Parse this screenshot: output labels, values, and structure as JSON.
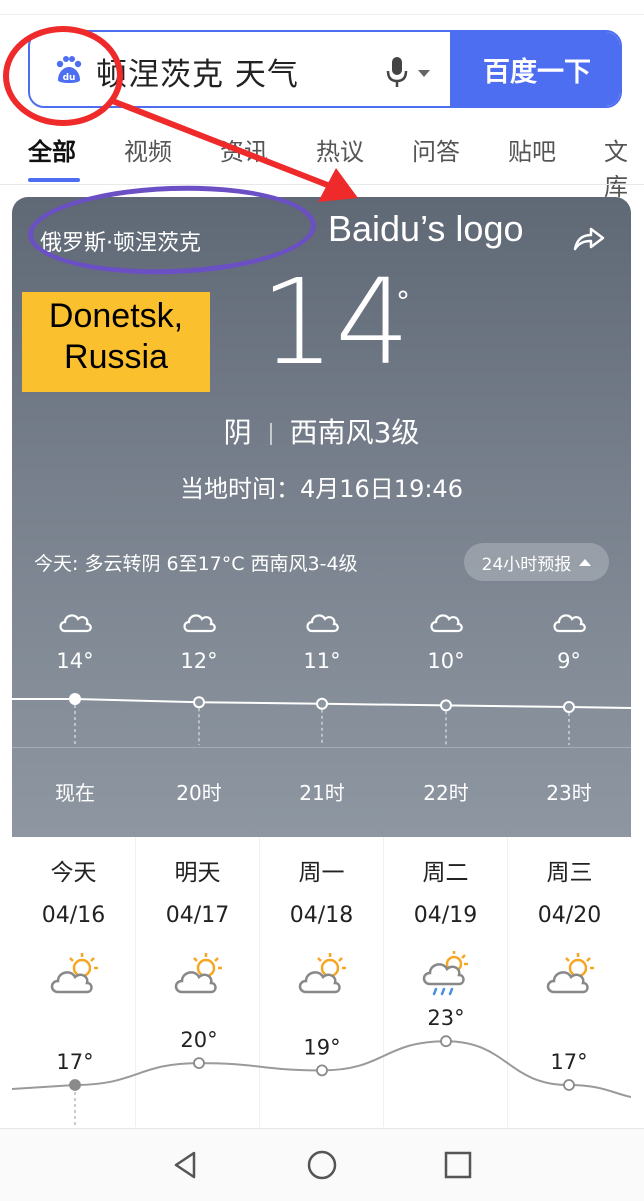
{
  "search": {
    "query": "顿涅茨克 天气",
    "button_label": "百度一下",
    "logo_text": "du"
  },
  "tabs": [
    {
      "label": "全部",
      "active": true
    },
    {
      "label": "视频"
    },
    {
      "label": "资讯"
    },
    {
      "label": "热议"
    },
    {
      "label": "问答"
    },
    {
      "label": "贴吧"
    },
    {
      "label": "文库"
    }
  ],
  "weather": {
    "location": "俄罗斯·顿涅茨克",
    "temperature": "14",
    "degree": "°",
    "condition": "阴",
    "wind": "西南风3级",
    "local_time": "当地时间：4月16日19:46",
    "today_summary": "今天: 多云转阴  6至17°C  西南风3-4级",
    "forecast_button": "24小时预报",
    "hourly": [
      {
        "temp": "14°",
        "time": "现在",
        "value": 14,
        "icon": "cloud-icon"
      },
      {
        "temp": "12°",
        "time": "20时",
        "value": 12,
        "icon": "cloud-icon"
      },
      {
        "temp": "11°",
        "time": "21时",
        "value": 11,
        "icon": "cloud-icon"
      },
      {
        "temp": "10°",
        "time": "22时",
        "value": 10,
        "icon": "cloud-icon"
      },
      {
        "temp": "9°",
        "time": "23时",
        "value": 9,
        "icon": "cloud-icon"
      }
    ],
    "daily": [
      {
        "day": "今天",
        "date": "04/16",
        "temp": "17°",
        "value": 17,
        "icon": "partly-cloudy-icon"
      },
      {
        "day": "明天",
        "date": "04/17",
        "temp": "20°",
        "value": 20,
        "icon": "partly-cloudy-icon"
      },
      {
        "day": "周一",
        "date": "04/18",
        "temp": "19°",
        "value": 19,
        "icon": "partly-cloudy-icon"
      },
      {
        "day": "周二",
        "date": "04/19",
        "temp": "23°",
        "value": 23,
        "icon": "rain-sun-icon"
      },
      {
        "day": "周三",
        "date": "04/20",
        "temp": "17°",
        "value": 17,
        "icon": "partly-cloudy-icon"
      }
    ]
  },
  "annotations": {
    "arrow_label": "Baidu’s logo",
    "location_box_line1": "Donetsk,",
    "location_box_line2": "Russia",
    "circle_color": "#ee2a2a",
    "oval_color": "#6b4fc4",
    "box_color": "#fbc02d"
  },
  "colors": {
    "accent": "#4e6ef2"
  }
}
